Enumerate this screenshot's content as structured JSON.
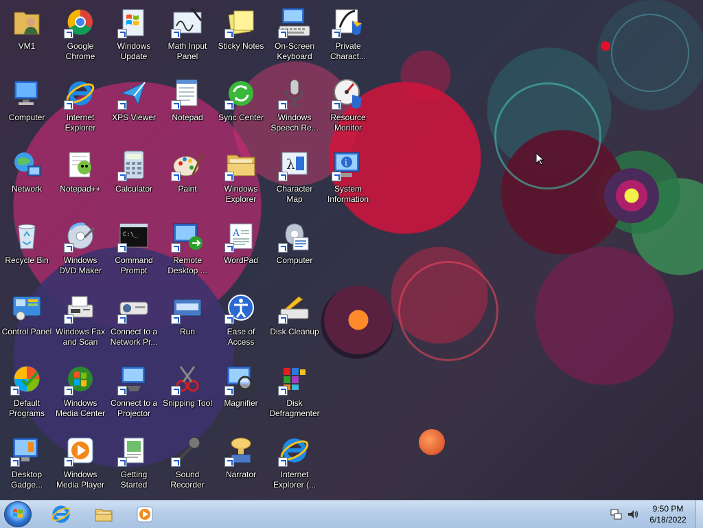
{
  "desktop": {
    "icons": [
      {
        "id": "vm1",
        "label": "VM1",
        "icon": "user-folder-icon",
        "shortcut": false
      },
      {
        "id": "computer",
        "label": "Computer",
        "icon": "computer-icon",
        "shortcut": false
      },
      {
        "id": "network",
        "label": "Network",
        "icon": "network-icon",
        "shortcut": false
      },
      {
        "id": "recycle-bin",
        "label": "Recycle Bin",
        "icon": "recycle-bin-icon",
        "shortcut": false
      },
      {
        "id": "control-panel",
        "label": "Control Panel",
        "icon": "control-panel-icon",
        "shortcut": false
      },
      {
        "id": "default-programs",
        "label": "Default\nPrograms",
        "icon": "default-programs-icon",
        "shortcut": true
      },
      {
        "id": "desktop-gadgets",
        "label": "Desktop\nGadge...",
        "icon": "desktop-gadgets-icon",
        "shortcut": true
      },
      {
        "id": "google-chrome",
        "label": "Google\nChrome",
        "icon": "chrome-icon",
        "shortcut": true
      },
      {
        "id": "internet-explorer",
        "label": "Internet\nExplorer",
        "icon": "internet-explorer-icon",
        "shortcut": true
      },
      {
        "id": "notepad-plus-plus",
        "label": "Notepad++",
        "icon": "notepad-plus-plus-icon",
        "shortcut": false
      },
      {
        "id": "windows-dvd-maker",
        "label": "Windows\nDVD Maker",
        "icon": "dvd-maker-icon",
        "shortcut": true
      },
      {
        "id": "windows-fax-scan",
        "label": "Windows Fax\nand Scan",
        "icon": "fax-scan-icon",
        "shortcut": true
      },
      {
        "id": "windows-media-center",
        "label": "Windows\nMedia Center",
        "icon": "media-center-icon",
        "shortcut": true
      },
      {
        "id": "windows-media-player",
        "label": "Windows\nMedia Player",
        "icon": "media-player-icon",
        "shortcut": true
      },
      {
        "id": "windows-update",
        "label": "Windows\nUpdate",
        "icon": "windows-update-icon",
        "shortcut": true
      },
      {
        "id": "xps-viewer",
        "label": "XPS Viewer",
        "icon": "xps-viewer-icon",
        "shortcut": true
      },
      {
        "id": "calculator",
        "label": "Calculator",
        "icon": "calculator-icon",
        "shortcut": true
      },
      {
        "id": "command-prompt",
        "label": "Command\nPrompt",
        "icon": "command-prompt-icon",
        "shortcut": true
      },
      {
        "id": "connect-network-projector",
        "label": "Connect to a\nNetwork Pr...",
        "icon": "network-projector-icon",
        "shortcut": true
      },
      {
        "id": "connect-projector",
        "label": "Connect to a\nProjector",
        "icon": "projector-icon",
        "shortcut": true
      },
      {
        "id": "getting-started",
        "label": "Getting\nStarted",
        "icon": "getting-started-icon",
        "shortcut": true
      },
      {
        "id": "math-input-panel",
        "label": "Math Input\nPanel",
        "icon": "math-input-icon",
        "shortcut": true
      },
      {
        "id": "notepad",
        "label": "Notepad",
        "icon": "notepad-icon",
        "shortcut": true
      },
      {
        "id": "paint",
        "label": "Paint",
        "icon": "paint-icon",
        "shortcut": true
      },
      {
        "id": "remote-desktop",
        "label": "Remote\nDesktop ...",
        "icon": "remote-desktop-icon",
        "shortcut": true
      },
      {
        "id": "run",
        "label": "Run",
        "icon": "run-icon",
        "shortcut": true
      },
      {
        "id": "snipping-tool",
        "label": "Snipping Tool",
        "icon": "snipping-tool-icon",
        "shortcut": true
      },
      {
        "id": "sound-recorder",
        "label": "Sound\nRecorder",
        "icon": "sound-recorder-icon",
        "shortcut": true
      },
      {
        "id": "sticky-notes",
        "label": "Sticky Notes",
        "icon": "sticky-notes-icon",
        "shortcut": true
      },
      {
        "id": "sync-center",
        "label": "Sync Center",
        "icon": "sync-center-icon",
        "shortcut": true
      },
      {
        "id": "windows-explorer",
        "label": "Windows\nExplorer",
        "icon": "windows-explorer-icon",
        "shortcut": true
      },
      {
        "id": "wordpad",
        "label": "WordPad",
        "icon": "wordpad-icon",
        "shortcut": true
      },
      {
        "id": "ease-of-access",
        "label": "Ease of\nAccess Center",
        "icon": "ease-of-access-icon",
        "shortcut": true
      },
      {
        "id": "magnifier",
        "label": "Magnifier",
        "icon": "magnifier-icon",
        "shortcut": true
      },
      {
        "id": "narrator",
        "label": "Narrator",
        "icon": "narrator-icon",
        "shortcut": true
      },
      {
        "id": "on-screen-keyboard",
        "label": "On-Screen\nKeyboard",
        "icon": "keyboard-icon",
        "shortcut": true
      },
      {
        "id": "windows-speech-recognition",
        "label": "Windows\nSpeech Re...",
        "icon": "microphone-icon",
        "shortcut": true
      },
      {
        "id": "character-map",
        "label": "Character\nMap",
        "icon": "character-map-icon",
        "shortcut": true
      },
      {
        "id": "computer-management",
        "label": "Computer",
        "icon": "computer-management-icon",
        "shortcut": true
      },
      {
        "id": "disk-cleanup",
        "label": "Disk Cleanup",
        "icon": "disk-cleanup-icon",
        "shortcut": true
      },
      {
        "id": "disk-defragmenter",
        "label": "Disk\nDefragmenter",
        "icon": "disk-defragmenter-icon",
        "shortcut": true
      },
      {
        "id": "internet-explorer-64",
        "label": "Internet\nExplorer (...",
        "icon": "internet-explorer-icon",
        "shortcut": true
      },
      {
        "id": "private-character-editor",
        "label": "Private\nCharact...",
        "icon": "private-character-icon",
        "shortcut": true
      },
      {
        "id": "resource-monitor",
        "label": "Resource\nMonitor",
        "icon": "resource-monitor-icon",
        "shortcut": true
      },
      {
        "id": "system-information",
        "label": "System\nInformation",
        "icon": "system-information-icon",
        "shortcut": true
      }
    ]
  },
  "taskbar": {
    "start_icon": "windows-start-orb-icon",
    "pinned": [
      {
        "id": "internet-explorer",
        "icon": "internet-explorer-icon"
      },
      {
        "id": "windows-explorer",
        "icon": "folder-icon"
      },
      {
        "id": "windows-media-player",
        "icon": "media-player-icon"
      }
    ],
    "tray": {
      "icons": [
        "network-tray-icon",
        "volume-icon"
      ],
      "time": "9:50 PM",
      "date": "6/18/2022"
    }
  }
}
